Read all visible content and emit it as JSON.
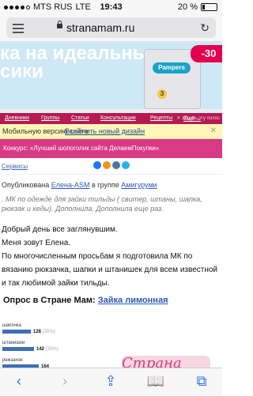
{
  "status_bar": {
    "carrier": "MTS RUS",
    "network": "LTE",
    "time": "19:43",
    "battery": "20 %",
    "battery_level": 0.2
  },
  "browser": {
    "url": "stranamam.ru",
    "menu_icon": "menu-icon",
    "reload_icon": "reload-icon"
  },
  "banner": {
    "text": "ка на идеальные\nсики",
    "brand": "Pampers",
    "size_label": "3",
    "discount": "-30"
  },
  "nav": {
    "items": [
      "Дневники",
      "Группы",
      "Статьи",
      "Консультации",
      "Рецепты",
      "Ещё ⌄"
    ],
    "remove": "✕ Убрать эту полос"
  },
  "version_bar": {
    "text": "Мобильную версию сайта",
    "link": "Включить новый дизайн"
  },
  "contest": {
    "text": "Конкурс: «Лучший шопоголик сайта ДелаемПокупки»"
  },
  "breadcrumbs": {
    "link": "Сервисы"
  },
  "post": {
    "published_prefix": "Опубликована",
    "author": "Елена-АSM",
    "group_prefix": "в группе",
    "group": "Амигуруми",
    "description": ". МК по одежде для зайки тильды ( свитер, штаны, шапка, рюкзак и кеды). Дополнила. Дополнила еще раз.",
    "paragraph1": "Добрый день все заглянувшим.",
    "paragraph2": "Меня зовут Елена.",
    "paragraph3": "По многочисленным просьбам я подготовила МК по вязанию рюкзачка, шапки и штанишек для всем известной и так любимой зайки тильды."
  },
  "poll": {
    "title_prefix": "Опрос в Стране Мам:",
    "title_link": "Зайка лимонная",
    "options": [
      {
        "label": "шапочка",
        "value": 128,
        "percent": "(30%)"
      },
      {
        "label": "штанишки",
        "value": 142,
        "percent": "(33%)"
      },
      {
        "label": "рюкзачок",
        "value": 164,
        "percent": ""
      }
    ]
  },
  "watermark": "Страна Мам",
  "toolbar": {
    "back": "‹",
    "forward": "›",
    "share": "⇪",
    "bookmarks": "📖",
    "tabs": "⧉"
  }
}
